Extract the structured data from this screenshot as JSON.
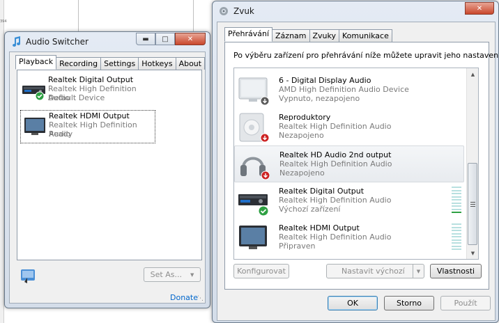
{
  "background": {
    "ruler_label": "394"
  },
  "audio_switcher": {
    "title": "Audio Switcher",
    "tabs": [
      "Playback",
      "Recording",
      "Settings",
      "Hotkeys",
      "About"
    ],
    "active_tab": "Playback",
    "devices": [
      {
        "name": "Realtek Digital Output",
        "driver": "Realtek High Definition Audio",
        "status": "Default Device",
        "icon": "digital-receiver-icon",
        "default": true
      },
      {
        "name": "Realtek HDMI Output",
        "driver": "Realtek High Definition Audio",
        "status": "Ready",
        "icon": "monitor-icon",
        "default": false
      }
    ],
    "set_as_label": "Set As...",
    "donate_label": "Donate"
  },
  "zvuk": {
    "title": "Zvuk",
    "tabs": [
      "Přehrávání",
      "Záznam",
      "Zvuky",
      "Komunikace"
    ],
    "active_tab": "Přehrávání",
    "instruction": "Po výběru zařízení pro přehrávání níže můžete upravit jeho nastavení:",
    "devices": [
      {
        "name": "6 - Digital Display Audio",
        "driver": "AMD High Definition Audio Device",
        "status": "Vypnuto, nezapojeno",
        "icon": "monitor-icon",
        "badge": "down-arrow"
      },
      {
        "name": "Reproduktory",
        "driver": "Realtek High Definition Audio",
        "status": "Nezapojeno",
        "icon": "speaker-icon",
        "badge": "red-down-arrow"
      },
      {
        "name": "Realtek HD Audio 2nd output",
        "driver": "Realtek High Definition Audio",
        "status": "Nezapojeno",
        "icon": "headphones-icon",
        "badge": "red-down-arrow"
      },
      {
        "name": "Realtek Digital Output",
        "driver": "Realtek High Definition Audio",
        "status": "Výchozí zařízení",
        "icon": "digital-receiver-icon",
        "badge": "green-check"
      },
      {
        "name": "Realtek HDMI Output",
        "driver": "Realtek High Definition Audio",
        "status": "Připraven",
        "icon": "monitor-icon",
        "badge": "none"
      }
    ],
    "configure_label": "Konfigurovat",
    "set_default_label": "Nastavit výchozí",
    "properties_label": "Vlastnosti",
    "ok_label": "OK",
    "cancel_label": "Storno",
    "apply_label": "Použít"
  },
  "colors": {
    "link": "#0066cc",
    "check_green": "#2ea043",
    "arrow_red": "#cc2222"
  }
}
